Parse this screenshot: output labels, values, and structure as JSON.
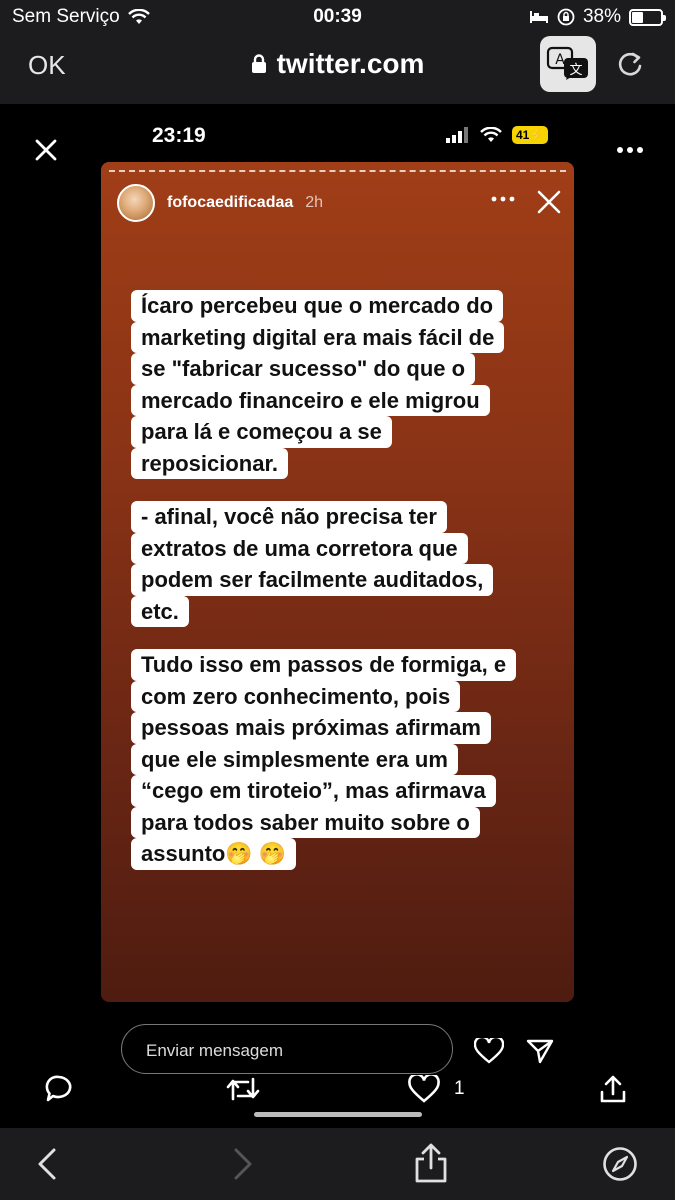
{
  "status_bar": {
    "carrier": "Sem Serviço",
    "time": "00:39",
    "battery": "38%",
    "battery_level": 0.38
  },
  "browser": {
    "done_label": "OK",
    "url": "twitter.com"
  },
  "screenshot": {
    "time": "23:19",
    "battery": "41"
  },
  "story": {
    "username": "fofocaedificadaa",
    "age": "2h",
    "paragraphs": [
      [
        "Ícaro percebeu que o mercado do",
        "marketing digital era mais fácil de",
        "se \"fabricar sucesso\" do que o",
        "mercado financeiro e ele migrou",
        "para lá e começou a se",
        "reposicionar."
      ],
      [
        "- afinal, você não precisa ter",
        "extratos de uma corretora que",
        "podem ser facilmente auditados,",
        "etc."
      ],
      [
        "Tudo isso em passos de formiga, e",
        "com zero conhecimento, pois",
        "pessoas mais próximas afirmam",
        "que ele simplesmente era um",
        "“cego em tiroteio”, mas afirmava",
        "para todos saber muito sobre o",
        "assunto🤭 🤭"
      ]
    ],
    "message_placeholder": "Enviar mensagem"
  },
  "tweet": {
    "like_count": "1"
  },
  "icons": {
    "wifi": "wifi-icon",
    "lock": "lock-icon",
    "translate": "translate-icon",
    "reload": "reload-icon",
    "close": "close-icon",
    "more": "more-icon",
    "reply": "reply-icon",
    "retweet": "retweet-icon",
    "like": "heart-icon",
    "share": "share-icon",
    "back": "back-icon",
    "forward": "forward-icon",
    "compass": "compass-icon",
    "send": "send-icon"
  }
}
